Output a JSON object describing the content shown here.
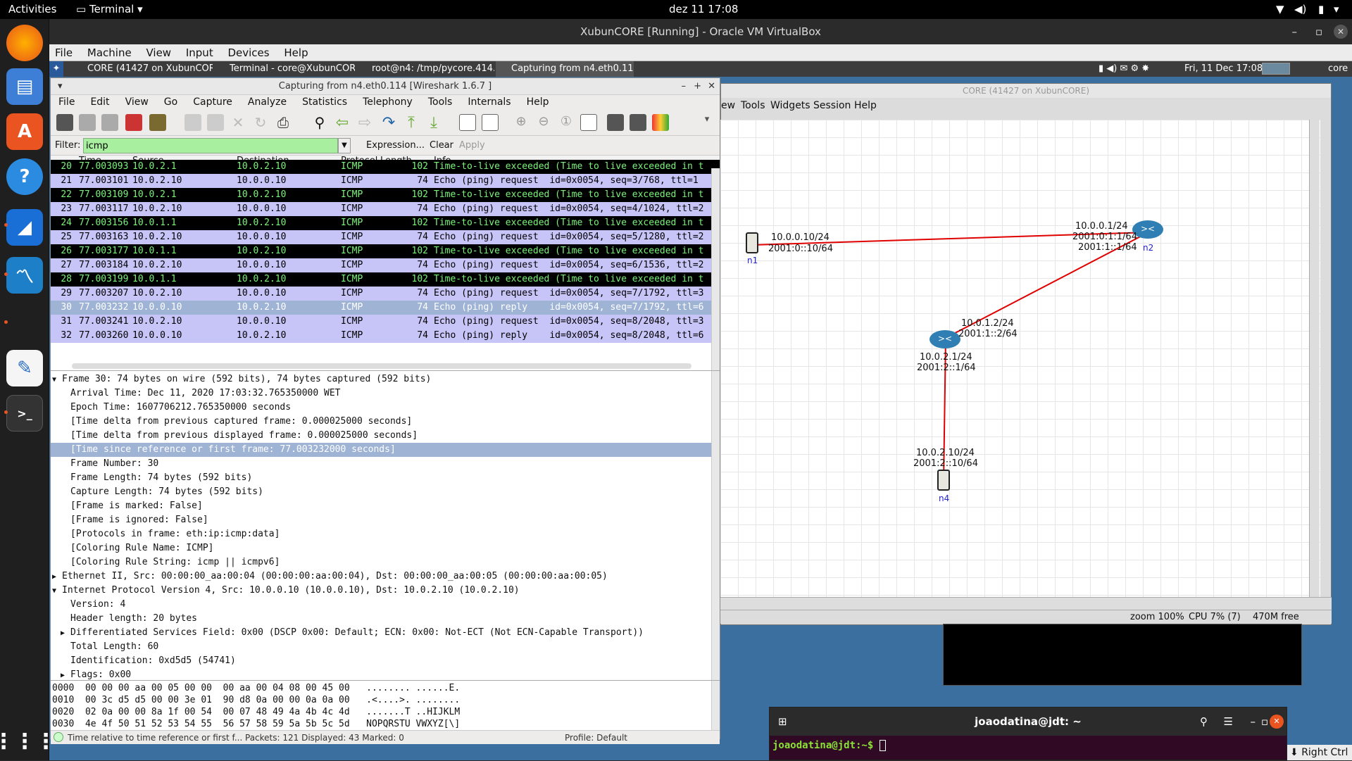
{
  "topbar": {
    "activities": "Activities",
    "app": "Terminal",
    "clock": "dez 11  17:08"
  },
  "vbox": {
    "title": "XubunCORE [Running] - Oracle VM VirtualBox",
    "menu": [
      "File",
      "Machine",
      "View",
      "Input",
      "Devices",
      "Help"
    ],
    "host_key": "Right Ctrl"
  },
  "xpanel": {
    "tasks": [
      "CORE (41427 on XubunCORE)",
      "Terminal - core@XubunCOR...",
      "root@n4: /tmp/pycore.414...",
      "Capturing from n4.eth0.114..."
    ],
    "clock": "Fri, 11 Dec  17:08",
    "user": "core"
  },
  "wireshark": {
    "title": "Capturing from n4.eth0.114   [Wireshark 1.6.7 ]",
    "menu": [
      "File",
      "Edit",
      "View",
      "Go",
      "Capture",
      "Analyze",
      "Statistics",
      "Telephony",
      "Tools",
      "Internals",
      "Help"
    ],
    "filter_label": "Filter:",
    "filter_value": "icmp",
    "filter_expression": "Expression...",
    "filter_clear": "Clear",
    "filter_apply": "Apply",
    "columns": [
      "Time",
      "Source",
      "Destination",
      "Protocol",
      "Length",
      "Info"
    ],
    "packets": [
      {
        "no": "20",
        "time": "77.003093",
        "src": "10.0.2.1",
        "dst": "10.0.2.10",
        "proto": "ICMP",
        "len": "102",
        "info": "Time-to-live exceeded (Time to live exceeded in t",
        "style": "black"
      },
      {
        "no": "21",
        "time": "77.003101",
        "src": "10.0.2.10",
        "dst": "10.0.0.10",
        "proto": "ICMP",
        "len": "74",
        "info": "Echo (ping) request  id=0x0054, seq=3/768, ttl=1",
        "style": "blue"
      },
      {
        "no": "22",
        "time": "77.003109",
        "src": "10.0.2.1",
        "dst": "10.0.2.10",
        "proto": "ICMP",
        "len": "102",
        "info": "Time-to-live exceeded (Time to live exceeded in t",
        "style": "black"
      },
      {
        "no": "23",
        "time": "77.003117",
        "src": "10.0.2.10",
        "dst": "10.0.0.10",
        "proto": "ICMP",
        "len": "74",
        "info": "Echo (ping) request  id=0x0054, seq=4/1024, ttl=2",
        "style": "blue"
      },
      {
        "no": "24",
        "time": "77.003156",
        "src": "10.0.1.1",
        "dst": "10.0.2.10",
        "proto": "ICMP",
        "len": "102",
        "info": "Time-to-live exceeded (Time to live exceeded in t",
        "style": "black"
      },
      {
        "no": "25",
        "time": "77.003163",
        "src": "10.0.2.10",
        "dst": "10.0.0.10",
        "proto": "ICMP",
        "len": "74",
        "info": "Echo (ping) request  id=0x0054, seq=5/1280, ttl=2",
        "style": "blue"
      },
      {
        "no": "26",
        "time": "77.003177",
        "src": "10.0.1.1",
        "dst": "10.0.2.10",
        "proto": "ICMP",
        "len": "102",
        "info": "Time-to-live exceeded (Time to live exceeded in t",
        "style": "black"
      },
      {
        "no": "27",
        "time": "77.003184",
        "src": "10.0.2.10",
        "dst": "10.0.0.10",
        "proto": "ICMP",
        "len": "74",
        "info": "Echo (ping) request  id=0x0054, seq=6/1536, ttl=2",
        "style": "blue"
      },
      {
        "no": "28",
        "time": "77.003199",
        "src": "10.0.1.1",
        "dst": "10.0.2.10",
        "proto": "ICMP",
        "len": "102",
        "info": "Time-to-live exceeded (Time to live exceeded in t",
        "style": "black"
      },
      {
        "no": "29",
        "time": "77.003207",
        "src": "10.0.2.10",
        "dst": "10.0.0.10",
        "proto": "ICMP",
        "len": "74",
        "info": "Echo (ping) request  id=0x0054, seq=7/1792, ttl=3",
        "style": "blue"
      },
      {
        "no": "30",
        "time": "77.003232",
        "src": "10.0.0.10",
        "dst": "10.0.2.10",
        "proto": "ICMP",
        "len": "74",
        "info": "Echo (ping) reply    id=0x0054, seq=7/1792, ttl=6",
        "style": "sel"
      },
      {
        "no": "31",
        "time": "77.003241",
        "src": "10.0.2.10",
        "dst": "10.0.0.10",
        "proto": "ICMP",
        "len": "74",
        "info": "Echo (ping) request  id=0x0054, seq=8/2048, ttl=3",
        "style": "blue"
      },
      {
        "no": "32",
        "time": "77.003260",
        "src": "10.0.0.10",
        "dst": "10.0.2.10",
        "proto": "ICMP",
        "len": "74",
        "info": "Echo (ping) reply    id=0x0054, seq=8/2048, ttl=6",
        "style": "blue"
      }
    ],
    "details": [
      {
        "text": "Frame 30: 74 bytes on wire (592 bits), 74 bytes captured (592 bits)",
        "level": 0,
        "arrow": "open"
      },
      {
        "text": "Arrival Time: Dec 11, 2020 17:03:32.765350000 WET",
        "level": 1,
        "arrow": ""
      },
      {
        "text": "Epoch Time: 1607706212.765350000 seconds",
        "level": 1,
        "arrow": ""
      },
      {
        "text": "[Time delta from previous captured frame: 0.000025000 seconds]",
        "level": 1,
        "arrow": ""
      },
      {
        "text": "[Time delta from previous displayed frame: 0.000025000 seconds]",
        "level": 1,
        "arrow": ""
      },
      {
        "text": "[Time since reference or first frame: 77.003232000 seconds]",
        "level": 1,
        "arrow": "",
        "selected": true
      },
      {
        "text": "Frame Number: 30",
        "level": 1,
        "arrow": ""
      },
      {
        "text": "Frame Length: 74 bytes (592 bits)",
        "level": 1,
        "arrow": ""
      },
      {
        "text": "Capture Length: 74 bytes (592 bits)",
        "level": 1,
        "arrow": ""
      },
      {
        "text": "[Frame is marked: False]",
        "level": 1,
        "arrow": ""
      },
      {
        "text": "[Frame is ignored: False]",
        "level": 1,
        "arrow": ""
      },
      {
        "text": "[Protocols in frame: eth:ip:icmp:data]",
        "level": 1,
        "arrow": ""
      },
      {
        "text": "[Coloring Rule Name: ICMP]",
        "level": 1,
        "arrow": ""
      },
      {
        "text": "[Coloring Rule String: icmp || icmpv6]",
        "level": 1,
        "arrow": ""
      },
      {
        "text": "Ethernet II, Src: 00:00:00_aa:00:04 (00:00:00:aa:00:04), Dst: 00:00:00_aa:00:05 (00:00:00:aa:00:05)",
        "level": 0,
        "arrow": "closed"
      },
      {
        "text": "Internet Protocol Version 4, Src: 10.0.0.10 (10.0.0.10), Dst: 10.0.2.10 (10.0.2.10)",
        "level": 0,
        "arrow": "open"
      },
      {
        "text": "Version: 4",
        "level": 1,
        "arrow": ""
      },
      {
        "text": "Header length: 20 bytes",
        "level": 1,
        "arrow": ""
      },
      {
        "text": "Differentiated Services Field: 0x00 (DSCP 0x00: Default; ECN: 0x00: Not-ECT (Not ECN-Capable Transport))",
        "level": 1,
        "arrow": "closed"
      },
      {
        "text": "Total Length: 60",
        "level": 1,
        "arrow": ""
      },
      {
        "text": "Identification: 0xd5d5 (54741)",
        "level": 1,
        "arrow": ""
      },
      {
        "text": "Flags: 0x00",
        "level": 1,
        "arrow": "closed"
      }
    ],
    "hex": [
      "0000  00 00 00 aa 00 05 00 00  00 aa 00 04 08 00 45 00   ........ ......E.",
      "0010  00 3c d5 d5 00 00 3e 01  90 d8 0a 00 00 0a 0a 00   .<....>. ........",
      "0020  02 0a 00 00 8a 1f 00 54  00 07 48 49 4a 4b 4c 4d   .......T ..HIJKLM",
      "0030  4e 4f 50 51 52 53 54 55  56 57 58 59 5a 5b 5c 5d   NOPQRSTU VWXYZ[\\]"
    ],
    "status_left": "Time relative to time reference or first f...",
    "status_packets": "Packets: 121 Displayed: 43 Marked: 0",
    "status_profile": "Profile: Default"
  },
  "core": {
    "title": "CORE (41427 on XubunCORE)",
    "menu": [
      "ew",
      "Tools",
      "Widgets",
      "Session",
      "Help"
    ],
    "nodes": {
      "n1": {
        "name": "n1",
        "addr1": "10.0.0.10/24",
        "addr2": "2001:0::10/64"
      },
      "n2": {
        "name": "n2",
        "addr1": "10.0.0.1/24",
        "addr_overlap": "2001:0:1:1/64",
        "addr2": "2001:1::1/64"
      },
      "n3": {
        "addr1": "10.0.1.2/24",
        "addr2": "2001:1::2/64",
        "addr3": "10.0.2.1/24",
        "addr4": "2001:2::1/64"
      },
      "n4": {
        "name": "n4",
        "addr1": "10.0.2.10/24",
        "addr2": "2001:2::10/64"
      }
    },
    "zoom": "zoom 100%",
    "cpu": "CPU 7% (7)",
    "mem": "470M free"
  },
  "terminal": {
    "title": "joaodatina@jdt: ~",
    "prompt": "joaodatina@jdt:~$ "
  },
  "colors": {
    "link": "#e00000",
    "accent": "#e95420",
    "router": "#2f7fb5"
  }
}
